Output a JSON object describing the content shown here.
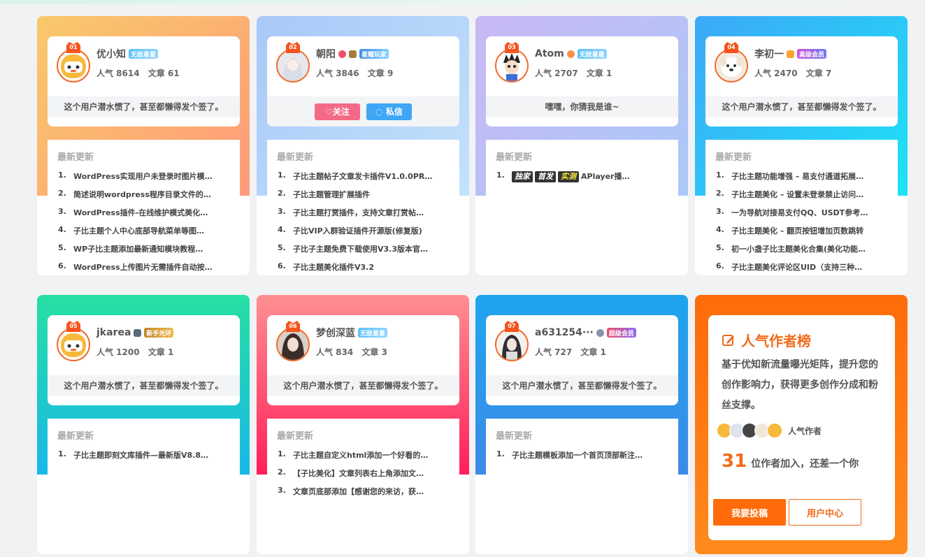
{
  "section_latest_label": "最新更新",
  "cards": [
    {
      "rank": "01",
      "name": "优小知",
      "badge": "无敌星星",
      "popularity": "人气 8614",
      "articles": "文章 61",
      "sign": "这个用户潜水惯了，甚至都懒得发个签了。",
      "posts": [
        "WordPress实现用户未登录时图片模…",
        "简述说明wordpress程序目录文件的…",
        "WordPress插件-在线维护模式美化…",
        "子比主题个人中心底部导航菜单等图…",
        "WP子比主题添加最新通知模块教程…",
        "WordPress上传图片无需插件自动按…"
      ]
    },
    {
      "rank": "02",
      "name": "朝阳",
      "badge": "星耀玩家",
      "popularity": "人气 3846",
      "articles": "文章 9",
      "follow_label": "♡关注",
      "message_label": "◌ 私信",
      "posts": [
        "子比主题帖子文章发卡插件V1.0.0PR…",
        "子比主题管理扩展插件",
        "子比主题打赏插件，支持文章打赏帖…",
        "子比VIP入群验证插件开源版(修复版)",
        "子比子主题免费下载使用V3.3版本官…",
        "子比主题美化插件V3.2"
      ]
    },
    {
      "rank": "03",
      "name": "Atom",
      "badge": "无敌星星",
      "popularity": "人气 2707",
      "articles": "文章 1",
      "sign": "嘿嘿，你猜我是谁~",
      "tags": [
        "独家",
        "首发",
        "实测"
      ],
      "posts": [
        "APlayer播…"
      ]
    },
    {
      "rank": "04",
      "name": "李初一",
      "badge": "高级会员",
      "popularity": "人气 2470",
      "articles": "文章 7",
      "sign": "这个用户潜水惯了，甚至都懒得发个签了。",
      "posts": [
        "子比主题功能增强 – 易支付通道拓展…",
        "子比主题美化 – 设置未登录禁止访问…",
        "一为导航对接易支付QQ、USDT参考…",
        "子比主题美化 – 翻页按钮增加页数跳转",
        "初一小盏子比主题美化合集(美化功能…",
        "子比主题美化评论区UID（支持三种…"
      ]
    },
    {
      "rank": "05",
      "name": "jkarea",
      "badge": "新手光环",
      "popularity": "人气 1200",
      "articles": "文章 1",
      "sign": "这个用户潜水惯了，甚至都懒得发个签了。",
      "posts": [
        "子比主题即刻文库插件—最新版V8.8…"
      ]
    },
    {
      "rank": "06",
      "name": "梦创深蓝",
      "badge": "无敌星星",
      "popularity": "人气 834",
      "articles": "文章 3",
      "sign": "这个用户潜水惯了，甚至都懒得发个签了。",
      "posts": [
        "子比主题自定义html添加一个好看的…",
        "【子比美化】文章列表右上角添加文…",
        "文章页底部添加【感谢您的来访，获…"
      ]
    },
    {
      "rank": "07",
      "name": "a631254···",
      "badge": "超级会员",
      "popularity": "人气 727",
      "articles": "文章 1",
      "sign": "这个用户潜水惯了，甚至都懒得发个签了。",
      "posts": [
        "子比主题模板添加一个首页顶部新注…"
      ]
    }
  ],
  "promo": {
    "title": "人气作者榜",
    "desc": "基于优知新流量曝光矩阵，提升您的创作影响力，获得更多创作分成和粉丝支撑。",
    "authors_label": "人气作者",
    "count": "31",
    "count_text": "位作者加入，还差一个你",
    "submit_label": "我要投稿",
    "center_label": "用户中心"
  },
  "colors": {
    "accent": "#ff6b0a",
    "rank_badge": "#f5541d",
    "follow": "#f46a86",
    "message": "#3ea6f5"
  }
}
